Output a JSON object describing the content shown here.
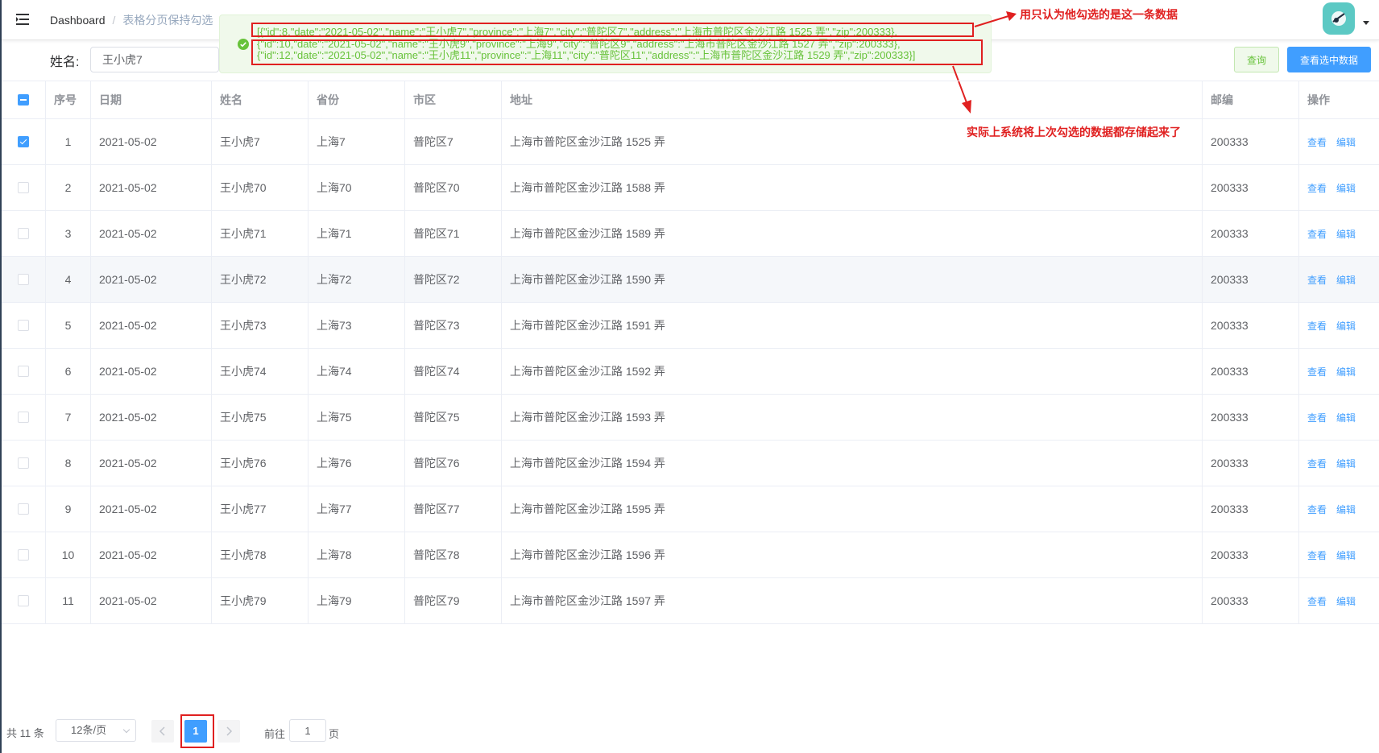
{
  "breadcrumb": {
    "home": "Dashboard",
    "separator": "/",
    "current": "表格分页保持勾选"
  },
  "search": {
    "label": "姓名:",
    "value": "王小虎7",
    "query_button": "查询",
    "view_selected_button": "查看选中数据"
  },
  "message": {
    "type": "success",
    "lines": [
      "[{\"id\":8,\"date\":\"2021-05-02\",\"name\":\"王小虎7\",\"province\":\"上海7\",\"city\":\"普陀区7\",\"address\":\"上海市普陀区金沙江路 1525 弄\",\"zip\":200333},",
      "{\"id\":10,\"date\":\"2021-05-02\",\"name\":\"王小虎9\",\"province\":\"上海9\",\"city\":\"普陀区9\",\"address\":\"上海市普陀区金沙江路 1527 弄\",\"zip\":200333},",
      "{\"id\":12,\"date\":\"2021-05-02\",\"name\":\"王小虎11\",\"province\":\"上海11\",\"city\":\"普陀区11\",\"address\":\"上海市普陀区金沙江路 1529 弄\",\"zip\":200333}]"
    ]
  },
  "annotations": {
    "note_top": "用只认为他勾选的是这一条数据",
    "note_middle": "实际上系统将上次勾选的数据都存储起来了"
  },
  "table": {
    "columns": [
      "序号",
      "日期",
      "姓名",
      "省份",
      "市区",
      "地址",
      "邮编",
      "操作"
    ],
    "op_view": "查看",
    "op_edit": "编辑",
    "rows": [
      {
        "index": "1",
        "date": "2021-05-02",
        "name": "王小虎7",
        "province": "上海7",
        "city": "普陀区7",
        "address": "上海市普陀区金沙江路 1525 弄",
        "zip": "200333",
        "checked": true
      },
      {
        "index": "2",
        "date": "2021-05-02",
        "name": "王小虎70",
        "province": "上海70",
        "city": "普陀区70",
        "address": "上海市普陀区金沙江路 1588 弄",
        "zip": "200333",
        "checked": false
      },
      {
        "index": "3",
        "date": "2021-05-02",
        "name": "王小虎71",
        "province": "上海71",
        "city": "普陀区71",
        "address": "上海市普陀区金沙江路 1589 弄",
        "zip": "200333",
        "checked": false
      },
      {
        "index": "4",
        "date": "2021-05-02",
        "name": "王小虎72",
        "province": "上海72",
        "city": "普陀区72",
        "address": "上海市普陀区金沙江路 1590 弄",
        "zip": "200333",
        "checked": false
      },
      {
        "index": "5",
        "date": "2021-05-02",
        "name": "王小虎73",
        "province": "上海73",
        "city": "普陀区73",
        "address": "上海市普陀区金沙江路 1591 弄",
        "zip": "200333",
        "checked": false
      },
      {
        "index": "6",
        "date": "2021-05-02",
        "name": "王小虎74",
        "province": "上海74",
        "city": "普陀区74",
        "address": "上海市普陀区金沙江路 1592 弄",
        "zip": "200333",
        "checked": false
      },
      {
        "index": "7",
        "date": "2021-05-02",
        "name": "王小虎75",
        "province": "上海75",
        "city": "普陀区75",
        "address": "上海市普陀区金沙江路 1593 弄",
        "zip": "200333",
        "checked": false
      },
      {
        "index": "8",
        "date": "2021-05-02",
        "name": "王小虎76",
        "province": "上海76",
        "city": "普陀区76",
        "address": "上海市普陀区金沙江路 1594 弄",
        "zip": "200333",
        "checked": false
      },
      {
        "index": "9",
        "date": "2021-05-02",
        "name": "王小虎77",
        "province": "上海77",
        "city": "普陀区77",
        "address": "上海市普陀区金沙江路 1595 弄",
        "zip": "200333",
        "checked": false
      },
      {
        "index": "10",
        "date": "2021-05-02",
        "name": "王小虎78",
        "province": "上海78",
        "city": "普陀区78",
        "address": "上海市普陀区金沙江路 1596 弄",
        "zip": "200333",
        "checked": false
      },
      {
        "index": "11",
        "date": "2021-05-02",
        "name": "王小虎79",
        "province": "上海79",
        "city": "普陀区79",
        "address": "上海市普陀区金沙江路 1597 弄",
        "zip": "200333",
        "checked": false
      }
    ]
  },
  "pagination": {
    "total": "共 11 条",
    "page_size": "12条/页",
    "current_page": "1",
    "goto_label": "前往",
    "goto_value": "1",
    "page_suffix": "页"
  },
  "colors": {
    "primary": "#409eff",
    "success": "#67c23a",
    "annotation": "#e02020"
  }
}
